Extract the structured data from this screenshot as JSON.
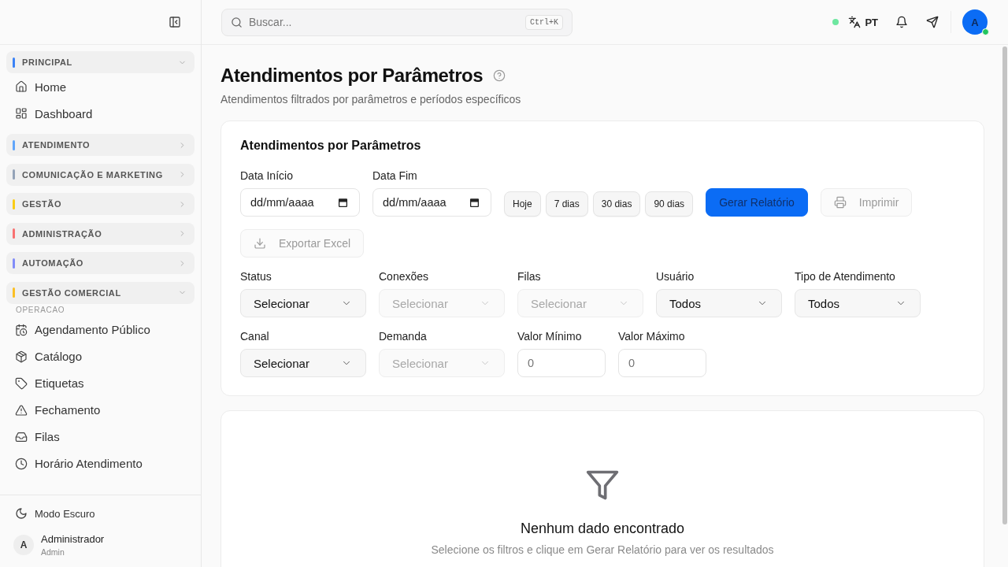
{
  "sidebar": {
    "sections": [
      {
        "title": "PRINCIPAL",
        "color": "#3b82f6",
        "expanded": true,
        "items": [
          {
            "label": "Home"
          },
          {
            "label": "Dashboard"
          }
        ]
      },
      {
        "title": "ATENDIMENTO",
        "color": "#60a5fa",
        "expanded": false
      },
      {
        "title": "COMUNICAÇÃO E MARKETING",
        "color": "#94a3b8",
        "expanded": false
      },
      {
        "title": "GESTÃO",
        "color": "#facc15",
        "expanded": false
      },
      {
        "title": "ADMINISTRAÇÃO",
        "color": "#f87171",
        "expanded": false
      },
      {
        "title": "AUTOMAÇÃO",
        "color": "#818cf8",
        "expanded": false
      },
      {
        "title": "GESTÃO COMERCIAL",
        "color": "#fbbf24",
        "expanded": true,
        "groups": [
          {
            "title": "OPERACAO",
            "items": [
              {
                "label": "Agendamento Público"
              },
              {
                "label": "Catálogo"
              },
              {
                "label": "Etiquetas"
              },
              {
                "label": "Fechamento"
              },
              {
                "label": "Filas"
              },
              {
                "label": "Horário Atendimento"
              }
            ]
          }
        ]
      }
    ],
    "footer": {
      "theme_toggle": "Modo Escuro",
      "user": {
        "initial": "A",
        "name": "Administrador",
        "role": "Admin"
      }
    }
  },
  "topbar": {
    "search": {
      "placeholder": "Buscar...",
      "shortcut": "Ctrl+K"
    },
    "connected": true,
    "language": "PT",
    "avatar": {
      "initial": "A",
      "online": true
    }
  },
  "page": {
    "title": "Atendimentos por Parâmetros",
    "subtitle": "Atendimentos filtrados por parâmetros e períodos específicos"
  },
  "filter_card": {
    "title": "Atendimentos por Parâmetros",
    "dates": [
      {
        "label": "Data Início",
        "placeholder": "dd/mm/aaaa"
      },
      {
        "label": "Data Fim",
        "placeholder": "dd/mm/aaaa"
      }
    ],
    "quick_ranges": [
      "Hoje",
      "7 dias",
      "30 dias",
      "90 dias"
    ],
    "actions": [
      {
        "label": "Gerar Relatório",
        "kind": "primary",
        "disabled": false
      },
      {
        "label": "Imprimir",
        "kind": "print",
        "disabled": true
      },
      {
        "label": "Exportar Excel",
        "kind": "export",
        "disabled": true
      }
    ],
    "filter_rows": [
      [
        {
          "label": "Status",
          "kind": "select",
          "value": "Selecionar",
          "disabled": false
        },
        {
          "label": "Conexões",
          "kind": "select",
          "value": "Selecionar",
          "disabled": true
        },
        {
          "label": "Filas",
          "kind": "select",
          "value": "Selecionar",
          "disabled": true
        },
        {
          "label": "Usuário",
          "kind": "select",
          "value": "Todos",
          "disabled": false
        },
        {
          "label": "Tipo de Atendimento",
          "kind": "select",
          "value": "Todos",
          "disabled": false
        }
      ],
      [
        {
          "label": "Canal",
          "kind": "select",
          "value": "Selecionar",
          "disabled": false
        },
        {
          "label": "Demanda",
          "kind": "select",
          "value": "Selecionar",
          "disabled": true
        },
        {
          "label": "Valor Mínimo",
          "kind": "number",
          "placeholder": "0"
        },
        {
          "label": "Valor Máximo",
          "kind": "number",
          "placeholder": "0"
        }
      ]
    ]
  },
  "empty_state": {
    "title": "Nenhum dado encontrado",
    "message": "Selecione os filtros e clique em Gerar Relatório para ver os resultados"
  }
}
